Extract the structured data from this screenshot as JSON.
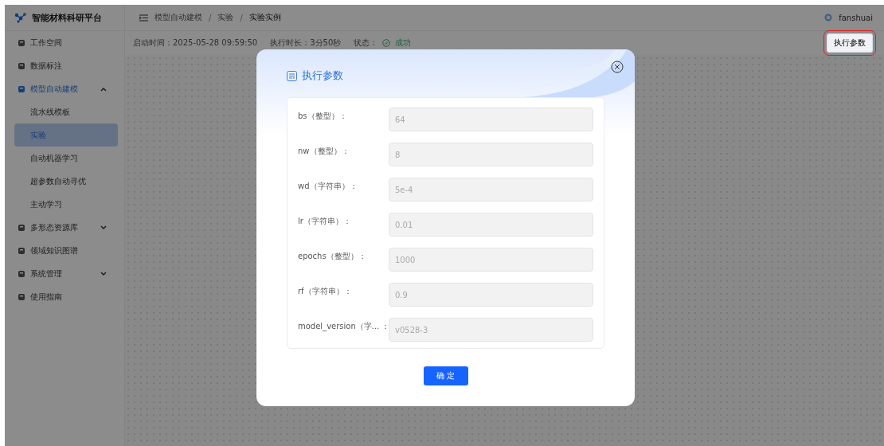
{
  "app": {
    "title": "智能材料科研平台"
  },
  "breadcrumb": [
    "模型自动建模",
    "实验",
    "实验实例"
  ],
  "breadcrumb_separator": "/",
  "user": {
    "name": "fanshuai"
  },
  "sidebar": {
    "items": [
      {
        "label": "工作空间",
        "selected": false
      },
      {
        "label": "数据标注",
        "selected": false
      },
      {
        "label": "模型自动建模",
        "selected": true,
        "expanded": true,
        "children": [
          {
            "label": "流水线模板",
            "selected": false
          },
          {
            "label": "实验",
            "selected": true
          },
          {
            "label": "自动机器学习",
            "selected": false
          },
          {
            "label": "超参数自动寻优",
            "selected": false
          },
          {
            "label": "主动学习",
            "selected": false
          }
        ]
      },
      {
        "label": "多形态资源库",
        "selected": false,
        "expanded": false
      },
      {
        "label": "领域知识图谱",
        "selected": false
      },
      {
        "label": "系统管理",
        "selected": false,
        "expanded": false
      },
      {
        "label": "使用指南",
        "selected": false
      }
    ]
  },
  "info_bar": {
    "start_time": "启动时间：2025-05-28 09:59:50",
    "duration": "执行时长：3分50秒",
    "status_label": "状态：",
    "status": "成功",
    "status_ok": true
  },
  "params_button": {
    "label": "执行参数",
    "highlighted": true
  },
  "dialog": {
    "title": "执行参数",
    "fields": [
      {
        "label": "bs（整型）：",
        "value": "64",
        "disabled": true
      },
      {
        "label": "nw（整型）：",
        "value": "8",
        "disabled": true
      },
      {
        "label": "wd（字符串）：",
        "value": "5e-4",
        "disabled": true
      },
      {
        "label": "lr（字符串）：",
        "value": "0.01",
        "disabled": true
      },
      {
        "label": "epochs（整型）：",
        "value": "1000",
        "disabled": true
      },
      {
        "label": "rf（字符串）：",
        "value": "0.9",
        "disabled": true
      },
      {
        "label": "model_version（字... ：",
        "value": "v0528-3",
        "disabled": true
      }
    ],
    "confirm": "确 定"
  }
}
